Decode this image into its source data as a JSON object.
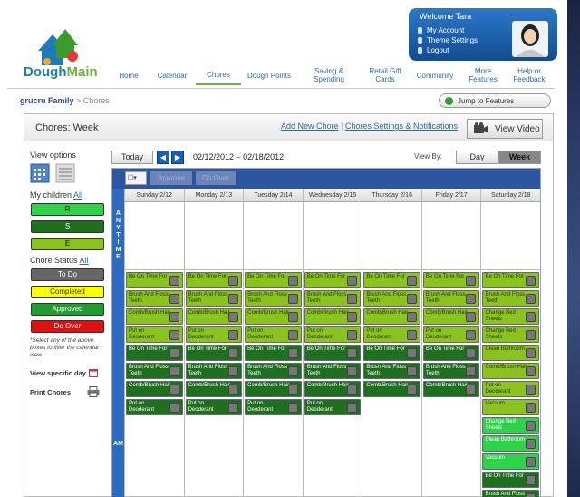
{
  "brand": {
    "logo_text_a": "Dough",
    "logo_text_b": "Main"
  },
  "welcome": {
    "greeting": "Welcome Tara",
    "links": [
      "My Account",
      "Theme Settings",
      "Logout"
    ]
  },
  "nav": [
    {
      "label": "Home",
      "active": false
    },
    {
      "label": "Calendar",
      "active": false
    },
    {
      "label": "Chores",
      "active": true
    },
    {
      "label": "Dough Points",
      "active": false
    },
    {
      "label": "Saving & Spending",
      "active": false
    },
    {
      "label": "Retail Gift Cards",
      "active": false
    },
    {
      "label": "Community",
      "active": false
    },
    {
      "label": "More Features",
      "active": false
    },
    {
      "label": "Help or Feedback",
      "active": false
    }
  ],
  "breadcrumb": {
    "family": "grucru Family",
    "sep": ">",
    "current": "Chores"
  },
  "jump": {
    "label": "Jump to Features"
  },
  "panel": {
    "title": "Chores: Week",
    "add_chore": "Add New Chore",
    "settings": "Chores Settings & Notifications",
    "view_video": "View Video"
  },
  "sidebar": {
    "view_options": "View options",
    "children_label": "My children",
    "all_link": "All",
    "children": [
      {
        "label": "R",
        "color": "#2ed34a"
      },
      {
        "label": "S",
        "color": "#1e6f1e"
      },
      {
        "label": "E",
        "color": "#8ac21e"
      }
    ],
    "status_label": "Chore Status",
    "statuses": [
      {
        "label": "To Do",
        "color": "#666666",
        "text": "#ffffff"
      },
      {
        "label": "Completed",
        "color": "#ffff00",
        "text": "#333333"
      },
      {
        "label": "Approved",
        "color": "#1e9e2e",
        "text": "#ffffff"
      },
      {
        "label": "Do Over",
        "color": "#dd1111",
        "text": "#ffffff"
      }
    ],
    "hint": "*Select any of the above boxes to filter the calendar view",
    "view_day": "View specific day",
    "print": "Print Chores"
  },
  "toolbar": {
    "today": "Today",
    "prev": "◀",
    "next": "▶",
    "range_start": "02/12/2012",
    "range_dash": "–",
    "range_end": "02/18/2012",
    "view_by": "View By:",
    "day": "Day",
    "week": "Week",
    "approve": "Approve",
    "do_over": "Do Over"
  },
  "calendar": {
    "anytime": "ANYTIME",
    "am": "AM",
    "days": [
      "Sunday 2/12",
      "Monday 2/13",
      "Tuesday 2/14",
      "Wednesday 2/15",
      "Thursday 2/16",
      "Friday 2/17",
      "Saturday 2/18"
    ],
    "columns": [
      [
        {
          "t": "Be On Time For",
          "c": "lg"
        },
        {
          "t": "Brush And Floss Teeth",
          "c": "lg"
        },
        {
          "t": "Comb/Brush Hair",
          "c": "lg"
        },
        {
          "t": "Put on Deoderant",
          "c": "lg"
        },
        {
          "t": "Be On Time For",
          "c": "dg"
        },
        {
          "t": "Brush And Floss Teeth",
          "c": "dg"
        },
        {
          "t": "Comb/Brush Hair",
          "c": "dg"
        },
        {
          "t": "Put on Deoderant",
          "c": "dg"
        }
      ],
      [
        {
          "t": "Be On Time For",
          "c": "lg"
        },
        {
          "t": "Brush And Floss Teeth",
          "c": "lg"
        },
        {
          "t": "Comb/Brush Hair",
          "c": "lg"
        },
        {
          "t": "Put on Deoderant",
          "c": "lg"
        },
        {
          "t": "Be On Time For",
          "c": "dg"
        },
        {
          "t": "Brush And Floss Teeth",
          "c": "dg"
        },
        {
          "t": "Comb/Brush Hair",
          "c": "dg"
        },
        {
          "t": "Put on Deoderant",
          "c": "dg"
        }
      ],
      [
        {
          "t": "Be On Time For",
          "c": "lg"
        },
        {
          "t": "Brush And Floss Teeth",
          "c": "lg"
        },
        {
          "t": "Comb/Brush Hair",
          "c": "lg"
        },
        {
          "t": "Put on Deoderant",
          "c": "lg"
        },
        {
          "t": "Be On Time For",
          "c": "dg"
        },
        {
          "t": "Brush And Floss Teeth",
          "c": "dg"
        },
        {
          "t": "Comb/Brush Hair",
          "c": "dg"
        },
        {
          "t": "Put on Deoderant",
          "c": "dg"
        }
      ],
      [
        {
          "t": "Be On Time For",
          "c": "lg"
        },
        {
          "t": "Brush And Floss Teeth",
          "c": "lg"
        },
        {
          "t": "Comb/Brush Hair",
          "c": "lg"
        },
        {
          "t": "Put on Deoderant",
          "c": "lg"
        },
        {
          "t": "Be On Time For",
          "c": "dg"
        },
        {
          "t": "Brush And Floss Teeth",
          "c": "dg"
        },
        {
          "t": "Comb/Brush Hair",
          "c": "dg"
        },
        {
          "t": "Put on Deoderant",
          "c": "dg"
        }
      ],
      [
        {
          "t": "Be On Time For",
          "c": "lg"
        },
        {
          "t": "Brush And Floss Teeth",
          "c": "lg"
        },
        {
          "t": "Comb/Brush Hair",
          "c": "lg"
        },
        {
          "t": "Put on Deoderant",
          "c": "lg"
        },
        {
          "t": "Be On Time For",
          "c": "dg"
        },
        {
          "t": "Brush And Floss Teeth",
          "c": "dg"
        },
        {
          "t": "Comb/Brush Hair",
          "c": "dg"
        }
      ],
      [
        {
          "t": "Be On Time For",
          "c": "lg"
        },
        {
          "t": "Brush And Floss Teeth",
          "c": "lg"
        },
        {
          "t": "Comb/Brush Hair",
          "c": "lg"
        },
        {
          "t": "Put on Deoderant",
          "c": "lg"
        },
        {
          "t": "Be On Time For",
          "c": "dg"
        },
        {
          "t": "Brush And Floss Teeth",
          "c": "dg"
        },
        {
          "t": "Comb/Brush Hair",
          "c": "dg"
        }
      ],
      [
        {
          "t": "Be On Time For",
          "c": "lg"
        },
        {
          "t": "Brush And Floss Teeth",
          "c": "lg"
        },
        {
          "t": "Change Bed Sheets",
          "c": "lg"
        },
        {
          "t": "Change Bed Sheets",
          "c": "lg"
        },
        {
          "t": "Clean Bathroom",
          "c": "lg"
        },
        {
          "t": "Comb/Brush Hair",
          "c": "lg"
        },
        {
          "t": "Put on Deoderant",
          "c": "lg"
        },
        {
          "t": "Vacuum",
          "c": "lg"
        },
        {
          "t": "Change Bed Sheets",
          "c": "bg"
        },
        {
          "t": "Clean Bathroom",
          "c": "bg"
        },
        {
          "t": "Vacuum",
          "c": "bg"
        },
        {
          "t": "Be On Time For",
          "c": "dg"
        },
        {
          "t": "Brush And Floss Teeth",
          "c": "dg"
        }
      ]
    ]
  }
}
